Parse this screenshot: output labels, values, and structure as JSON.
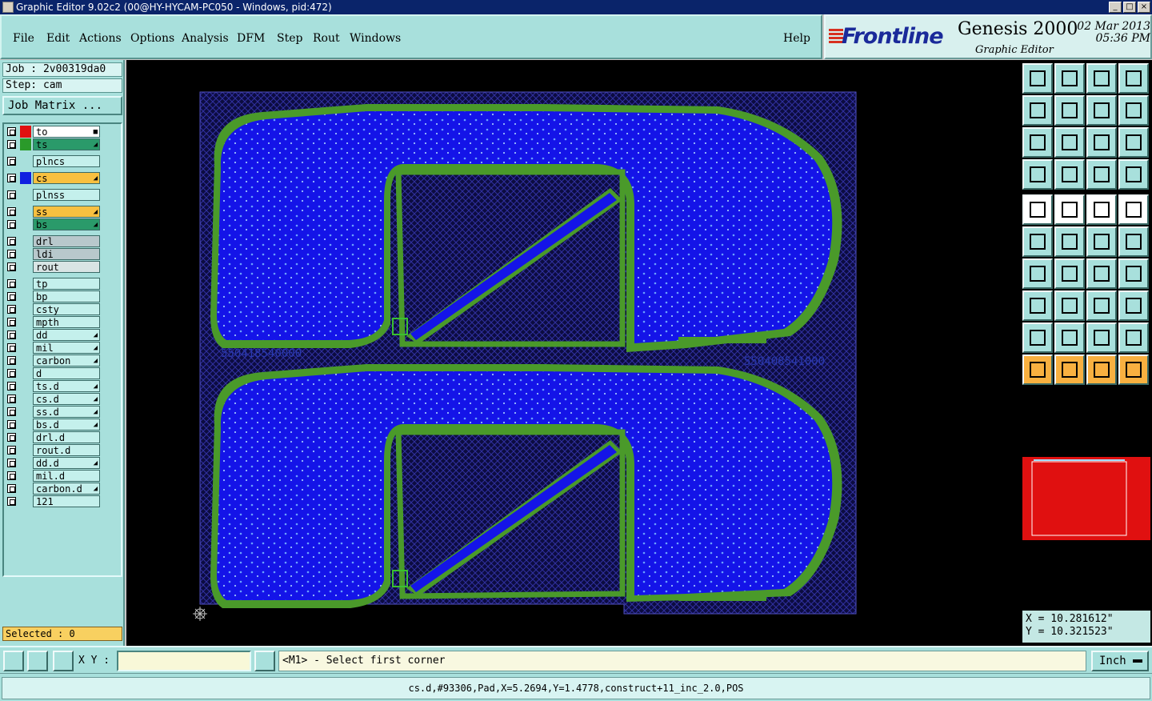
{
  "window": {
    "title": "Graphic Editor 9.02c2 (00@HY-HYCAM-PC050 - Windows, pid:472)"
  },
  "menu": {
    "items": [
      "File",
      "Edit",
      "Actions",
      "Options",
      "Analysis",
      "DFM",
      "Step",
      "Rout",
      "Windows"
    ],
    "help": "Help"
  },
  "brand": {
    "logo": "Frontline",
    "product": "Genesis 2000",
    "module": "Graphic Editor",
    "date": "02 Mar 2013",
    "time": "05:36 PM"
  },
  "job": {
    "job_line": "Job : 2v00319da0",
    "step_line": "Step: cam",
    "matrix_button": "Job Matrix ..."
  },
  "layers": [
    {
      "name": "to",
      "color": "#e01010",
      "bg": "#ffffff",
      "flag": "■"
    },
    {
      "name": "ts",
      "color": "#2a9a2a",
      "bg": "#2a9a6a",
      "flag": "◢"
    },
    {
      "name": "plncs",
      "color": "",
      "bg": "#c4f0ec",
      "flag": ""
    },
    {
      "name": "cs",
      "color": "#1020e0",
      "bg": "#f8c040",
      "flag": "◢"
    },
    {
      "name": "plnss",
      "color": "",
      "bg": "#c4f0ec",
      "flag": ""
    },
    {
      "name": "ss",
      "color": "",
      "bg": "#f8c040",
      "flag": "◢"
    },
    {
      "name": "bs",
      "color": "",
      "bg": "#2a9a6a",
      "flag": "◢"
    },
    {
      "name": "drl",
      "color": "",
      "bg": "#b8c8cc",
      "flag": ""
    },
    {
      "name": "ldi",
      "color": "",
      "bg": "#b8c8cc",
      "flag": ""
    },
    {
      "name": "rout",
      "color": "",
      "bg": "#d8e4e4",
      "flag": ""
    },
    {
      "name": "tp",
      "color": "",
      "bg": "#c4f0ec",
      "flag": ""
    },
    {
      "name": "bp",
      "color": "",
      "bg": "#c4f0ec",
      "flag": ""
    },
    {
      "name": "csty",
      "color": "",
      "bg": "#c4f0ec",
      "flag": ""
    },
    {
      "name": "mpth",
      "color": "",
      "bg": "#c4f0ec",
      "flag": ""
    },
    {
      "name": "dd",
      "color": "",
      "bg": "#c4f0ec",
      "flag": "◢"
    },
    {
      "name": "mil",
      "color": "",
      "bg": "#c4f0ec",
      "flag": "◢"
    },
    {
      "name": "carbon",
      "color": "",
      "bg": "#c4f0ec",
      "flag": "◢"
    },
    {
      "name": "d",
      "color": "",
      "bg": "#c4f0ec",
      "flag": ""
    },
    {
      "name": "ts.d",
      "color": "",
      "bg": "#c4f0ec",
      "flag": "◢"
    },
    {
      "name": "cs.d",
      "color": "",
      "bg": "#c4f0ec",
      "flag": "◢"
    },
    {
      "name": "ss.d",
      "color": "",
      "bg": "#c4f0ec",
      "flag": "◢"
    },
    {
      "name": "bs.d",
      "color": "",
      "bg": "#c4f0ec",
      "flag": "◢"
    },
    {
      "name": "drl.d",
      "color": "",
      "bg": "#c4f0ec",
      "flag": ""
    },
    {
      "name": "rout.d",
      "color": "",
      "bg": "#c4f0ec",
      "flag": ""
    },
    {
      "name": "dd.d",
      "color": "",
      "bg": "#c4f0ec",
      "flag": "◢"
    },
    {
      "name": "mil.d",
      "color": "",
      "bg": "#c4f0ec",
      "flag": ""
    },
    {
      "name": "carbon.d",
      "color": "",
      "bg": "#c4f0ec",
      "flag": "◢"
    },
    {
      "name": "121",
      "color": "",
      "bg": "#c4f0ec",
      "flag": ""
    }
  ],
  "selected_text": "Selected : 0",
  "board": {
    "label_top_left": "550418540000",
    "label_right": "550408541000",
    "copper_color": "#1414e8",
    "mask_color": "#4a9a2a",
    "hatch_color": "#3030a0"
  },
  "coords": {
    "x": "X  =  10.281612\"",
    "y": "Y  =  10.321523\""
  },
  "bottom": {
    "xy_label": "X Y :",
    "xy_value": "",
    "prompt": "<M1> - Select first corner",
    "unit": "Inch"
  },
  "status": {
    "text": "cs.d,#93306,Pad,X=5.2694,Y=1.4778,construct+11_inc_2.0,POS"
  },
  "toolbar_icons": [
    "open-step-icon",
    "save-icon",
    "home-icon",
    "window-split-icon",
    "pan-left-icon",
    "pan-right-icon",
    "undo-zoom-icon",
    "redo-zoom-icon",
    "zoom-fit-icon",
    "zoom-center-icon",
    "zoom-1-2-icon",
    "query-icon",
    "tools-icon",
    "grid-icon",
    "snap-red-icon",
    "snap-red-2-icon",
    "fill-mode-icon",
    "outline-mode-icon",
    "ruler-icon",
    "pad-icon",
    "connect-icon",
    "cross-icon",
    "line-red-icon",
    "line-blue-icon",
    "angle-line-icon",
    "diagonal-line-icon",
    "arc-icon",
    "mirror-f-icon",
    "move-pads-icon",
    "minus-line-icon",
    "measure-icon",
    "shapes-icon",
    "triangle-1-icon",
    "triangle-2-icon",
    "triangle-3-icon",
    "triangle-4-icon",
    "pointer-icon",
    "pointer-box-icon",
    "pointer-box-2-icon",
    "pointer-route-icon"
  ]
}
